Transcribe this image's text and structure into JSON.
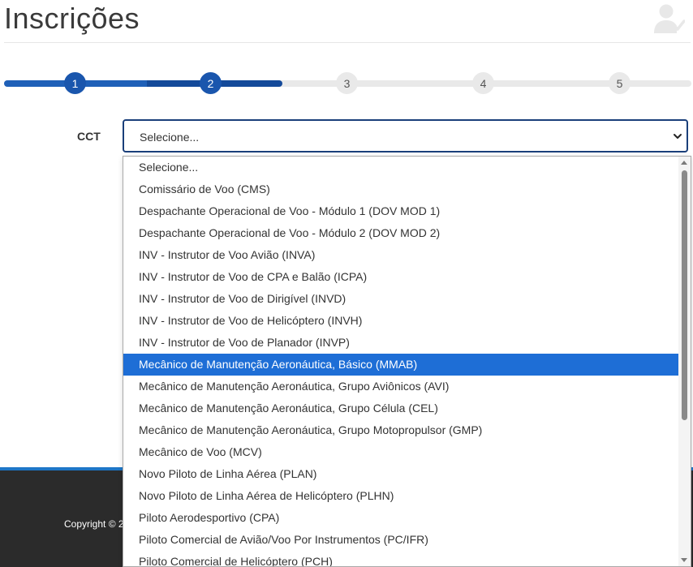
{
  "page": {
    "title": "Inscrições"
  },
  "header": {
    "icon": "user-check-icon"
  },
  "stepper": {
    "steps": [
      "1",
      "2",
      "3",
      "4",
      "5"
    ],
    "current_step": 2
  },
  "form": {
    "cct_label": "CCT",
    "cct_value": "Selecione...",
    "options": [
      "Selecione...",
      "Comissário de Voo (CMS)",
      "Despachante Operacional de Voo - Módulo 1 (DOV MOD 1)",
      "Despachante Operacional de Voo - Módulo 2 (DOV MOD 2)",
      "INV - Instrutor de Voo Avião (INVA)",
      "INV - Instrutor de Voo de CPA e Balão (ICPA)",
      "INV - Instrutor de Voo de Dirigível (INVD)",
      "INV - Instrutor de Voo de Helicóptero (INVH)",
      "INV - Instrutor de Voo de Planador (INVP)",
      "Mecânico de Manutenção Aeronáutica, Básico (MMAB)",
      "Mecânico de Manutenção Aeronáutica, Grupo Aviônicos (AVI)",
      "Mecânico de Manutenção Aeronáutica, Grupo Célula (CEL)",
      "Mecânico de Manutenção Aeronáutica, Grupo Motopropulsor (GMP)",
      "Mecânico de Voo (MCV)",
      "Novo Piloto de Linha Aérea (PLAN)",
      "Novo Piloto de Linha Aérea de Helicóptero (PLHN)",
      "Piloto Aerodesportivo (CPA)",
      "Piloto Comercial de Avião/Voo Por Instrumentos (PC/IFR)",
      "Piloto Comercial de Helicóptero (PCH)"
    ],
    "highlighted_option": "Mecânico de Manutenção Aeronáutica, Básico (MMAB)"
  },
  "footer": {
    "copyright": "Copyright © 2"
  },
  "colors": {
    "accent": "#1a56ad",
    "highlight": "#1e6ed6",
    "footer": "#2b2b2b",
    "footer_bar": "#1d76c7"
  }
}
